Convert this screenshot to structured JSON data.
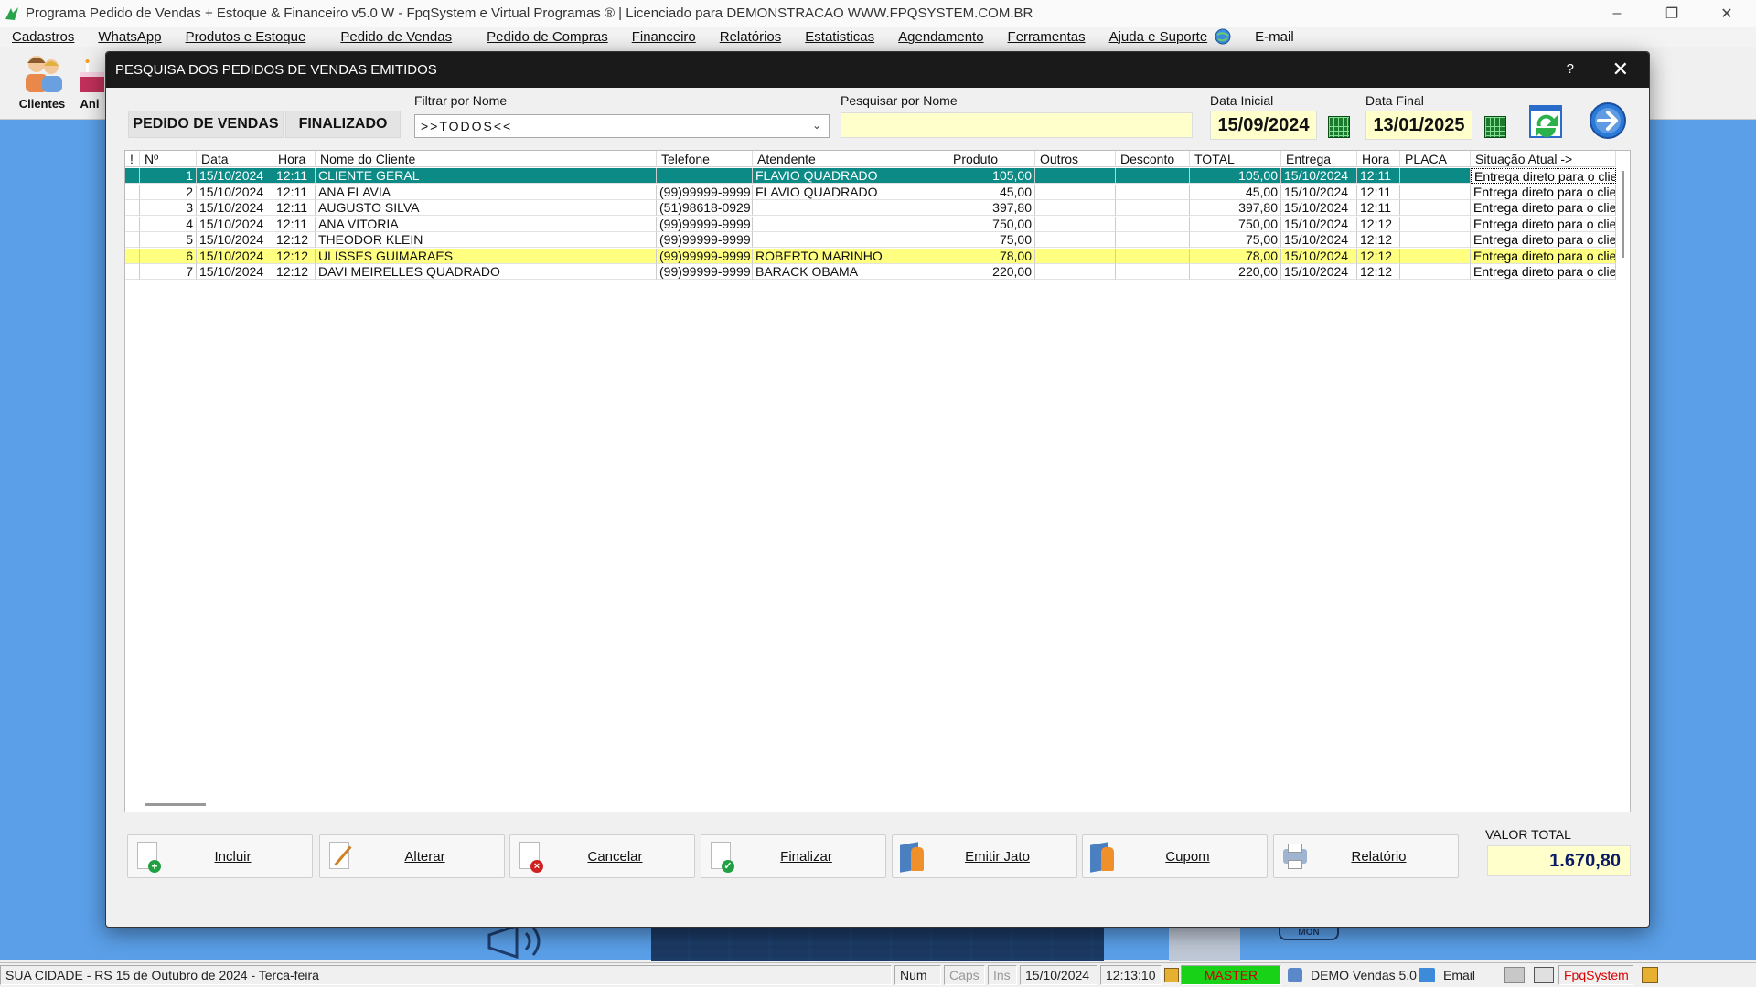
{
  "window": {
    "title": "Programa Pedido de Vendas + Estoque & Financeiro v5.0 W - FpqSystem e Virtual Programas ® | Licenciado para  DEMONSTRACAO WWW.FPQSYSTEM.COM.BR"
  },
  "menu": [
    "Cadastros",
    "WhatsApp",
    "Produtos e Estoque",
    "Pedido de Vendas",
    "Pedido de Compras",
    "Financeiro",
    "Relatórios",
    "Estatisticas",
    "Agendamento",
    "Ferramentas",
    "Ajuda e Suporte",
    "E-mail"
  ],
  "toolbar": {
    "clientes": "Clientes",
    "ani": "Ani"
  },
  "dialog": {
    "title": "PESQUISA DOS PEDIDOS DE VENDAS EMITIDOS",
    "help": "?",
    "tab_pedido": "PEDIDO DE VENDAS",
    "tab_finalizado": "FINALIZADO",
    "filter_label": "Filtrar por Nome",
    "filter_value": ">>TODOS<<",
    "search_label": "Pesquisar por Nome",
    "search_value": "",
    "date_start_label": "Data Inicial",
    "date_start": "15/09/2024",
    "date_end_label": "Data Final",
    "date_end": "13/01/2025"
  },
  "grid": {
    "columns": [
      "!",
      "Nº",
      "Data",
      "Hora",
      "Nome do Cliente",
      "Telefone",
      "Atendente",
      "Produto",
      "Outros",
      "Desconto",
      "TOTAL",
      "Entrega",
      "Hora",
      "PLACA",
      "Situação Atual ->"
    ],
    "rows": [
      {
        "n": "1",
        "data": "15/10/2024",
        "hora": "12:11",
        "cliente": "CLIENTE GERAL",
        "telefone": "",
        "atendente": "FLAVIO QUADRADO",
        "produto": "105,00",
        "outros": "",
        "desconto": "",
        "total": "105,00",
        "entrega": "15/10/2024",
        "hora2": "12:11",
        "placa": "",
        "situacao": "Entrega direto para o clien"
      },
      {
        "n": "2",
        "data": "15/10/2024",
        "hora": "12:11",
        "cliente": "ANA FLAVIA",
        "telefone": "(99)99999-9999",
        "atendente": "FLAVIO QUADRADO",
        "produto": "45,00",
        "outros": "",
        "desconto": "",
        "total": "45,00",
        "entrega": "15/10/2024",
        "hora2": "12:11",
        "placa": "",
        "situacao": "Entrega direto para o clien"
      },
      {
        "n": "3",
        "data": "15/10/2024",
        "hora": "12:11",
        "cliente": "AUGUSTO SILVA",
        "telefone": "(51)98618-0929",
        "atendente": "",
        "produto": "397,80",
        "outros": "",
        "desconto": "",
        "total": "397,80",
        "entrega": "15/10/2024",
        "hora2": "12:11",
        "placa": "",
        "situacao": "Entrega direto para o clien"
      },
      {
        "n": "4",
        "data": "15/10/2024",
        "hora": "12:11",
        "cliente": "ANA VITORIA",
        "telefone": "(99)99999-9999",
        "atendente": "",
        "produto": "750,00",
        "outros": "",
        "desconto": "",
        "total": "750,00",
        "entrega": "15/10/2024",
        "hora2": "12:12",
        "placa": "",
        "situacao": "Entrega direto para o clien"
      },
      {
        "n": "5",
        "data": "15/10/2024",
        "hora": "12:12",
        "cliente": "THEODOR KLEIN",
        "telefone": "(99)99999-9999",
        "atendente": "",
        "produto": "75,00",
        "outros": "",
        "desconto": "",
        "total": "75,00",
        "entrega": "15/10/2024",
        "hora2": "12:12",
        "placa": "",
        "situacao": "Entrega direto para o clien"
      },
      {
        "n": "6",
        "data": "15/10/2024",
        "hora": "12:12",
        "cliente": "ULISSES GUIMARAES",
        "telefone": "(99)99999-9999",
        "atendente": "ROBERTO MARINHO",
        "produto": "78,00",
        "outros": "",
        "desconto": "",
        "total": "78,00",
        "entrega": "15/10/2024",
        "hora2": "12:12",
        "placa": "",
        "situacao": "Entrega direto para o clien"
      },
      {
        "n": "7",
        "data": "15/10/2024",
        "hora": "12:12",
        "cliente": "DAVI MEIRELLES QUADRADO",
        "telefone": "(99)99999-9999",
        "atendente": "BARACK OBAMA",
        "produto": "220,00",
        "outros": "",
        "desconto": "",
        "total": "220,00",
        "entrega": "15/10/2024",
        "hora2": "12:12",
        "placa": "",
        "situacao": "Entrega direto para o clien"
      }
    ],
    "selected_row": 1,
    "highlight_row": 6
  },
  "actions": {
    "incluir": "Incluir",
    "alterar": "Alterar",
    "cancelar": "Cancelar",
    "finalizar": "Finalizar",
    "emitir_jato": "Emitir Jato",
    "cupom": "Cupom",
    "relatorio": "Relatório"
  },
  "total": {
    "label": "VALOR TOTAL",
    "value": "1.670,80"
  },
  "statusbar": {
    "location": "SUA CIDADE - RS 15 de Outubro de 2024 - Terca-feira",
    "num": "Num",
    "caps": "Caps",
    "ins": "Ins",
    "date": "15/10/2024",
    "time": "12:13:10",
    "user": "MASTER",
    "version": "DEMO Vendas 5.0",
    "email": "Email",
    "brand": "FpqSystem"
  },
  "colors": {
    "selected_row": "#0b8a86",
    "highlight_row": "#ffff80",
    "input_bg": "#ffffcc",
    "desktop": "#5a9fe8",
    "status_master": "#17d217"
  }
}
